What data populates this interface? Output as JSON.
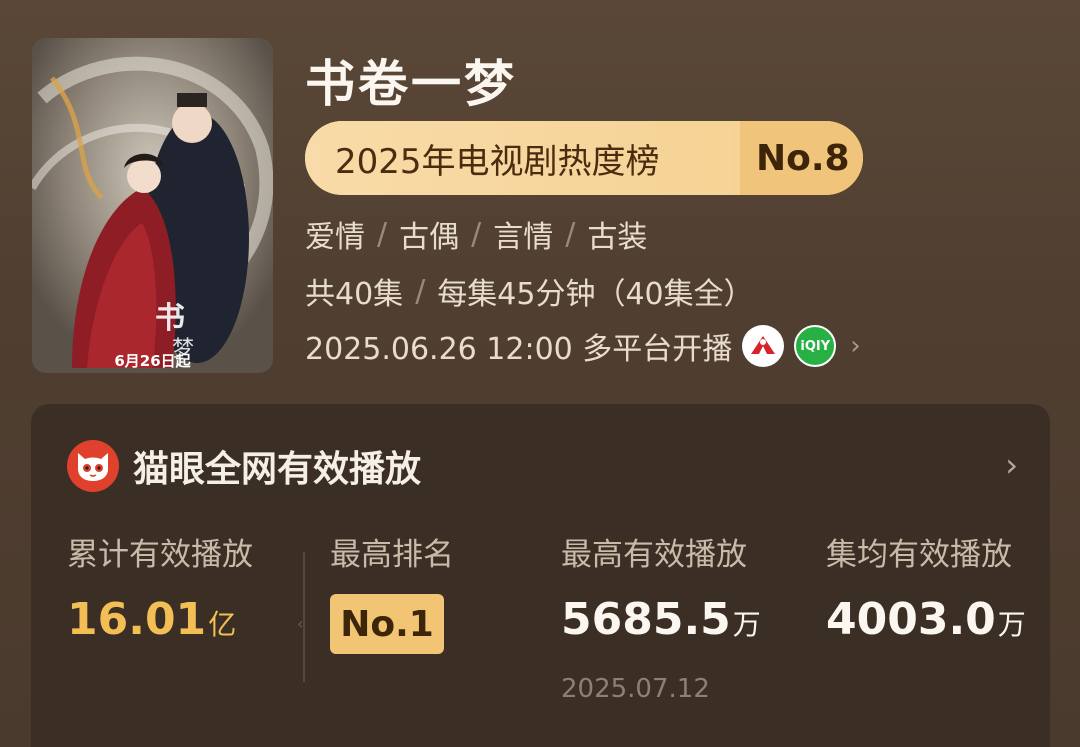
{
  "drama": {
    "title": "书卷一梦",
    "poster": {
      "date_text": "6月26日起",
      "calligraphy_title": "书卷一梦"
    },
    "ranking": {
      "label": "2025年电视剧热度榜",
      "rank": "No.8",
      "chevron": "›"
    },
    "genres": [
      "爱情",
      "古偶",
      "言情",
      "古装"
    ],
    "separator": "/",
    "episodes": {
      "total": "共40集",
      "detail": "每集45分钟（40集全）"
    },
    "release": {
      "text": "2025.06.26 12:00 多平台开播",
      "platforms": [
        {
          "icon": "platform-red-logo-icon"
        },
        {
          "icon": "iqiyi-icon",
          "label": "iQIY"
        }
      ],
      "chevron": "›"
    }
  },
  "maoyan": {
    "title": "猫眼全网有效播放",
    "logo_icon": "maoyan-cat-icon",
    "chevron": "›",
    "stats": [
      {
        "label": "累计有效播放",
        "value": "16.01",
        "unit": "亿"
      },
      {
        "label": "最高排名",
        "value": "No.1"
      },
      {
        "label": "最高有效播放",
        "value": "5685.5",
        "unit": "万",
        "sub": "2025.07.12"
      },
      {
        "label": "集均有效播放",
        "value": "4003.0",
        "unit": "万"
      }
    ]
  },
  "colors": {
    "background": "#503f31",
    "card": "#3b2f25",
    "pill_light": "#f8dba8",
    "pill_dark": "#f0c57b",
    "gold_value": "#f3bf55",
    "maoyan_red": "#e0412c",
    "iqiyi_green": "#27b043"
  }
}
